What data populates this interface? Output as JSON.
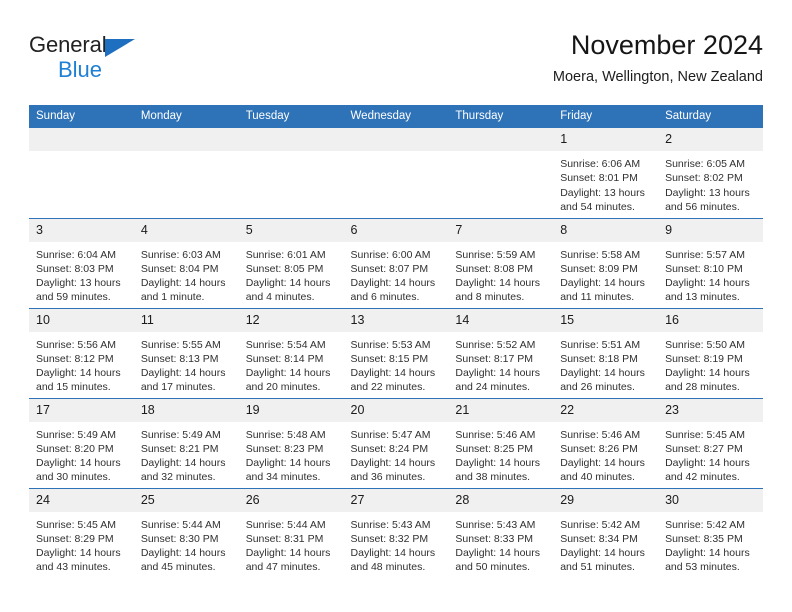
{
  "brand": {
    "word1": "General",
    "word2": "Blue",
    "triangle_color": "#1f6fc0",
    "word2_color": "#1f7fd4"
  },
  "header": {
    "title": "November 2024",
    "subtitle": "Moera, Wellington, New Zealand",
    "header_bg": "#2e72b8",
    "header_text": "#ffffff",
    "daynum_bg": "#f0f0f0"
  },
  "weekdays": [
    "Sunday",
    "Monday",
    "Tuesday",
    "Wednesday",
    "Thursday",
    "Friday",
    "Saturday"
  ],
  "weeks": [
    [
      {
        "day": "",
        "lines": []
      },
      {
        "day": "",
        "lines": []
      },
      {
        "day": "",
        "lines": []
      },
      {
        "day": "",
        "lines": []
      },
      {
        "day": "",
        "lines": []
      },
      {
        "day": "1",
        "lines": [
          "Sunrise: 6:06 AM",
          "Sunset: 8:01 PM",
          "Daylight: 13 hours",
          "and 54 minutes."
        ]
      },
      {
        "day": "2",
        "lines": [
          "Sunrise: 6:05 AM",
          "Sunset: 8:02 PM",
          "Daylight: 13 hours",
          "and 56 minutes."
        ]
      }
    ],
    [
      {
        "day": "3",
        "lines": [
          "Sunrise: 6:04 AM",
          "Sunset: 8:03 PM",
          "Daylight: 13 hours",
          "and 59 minutes."
        ]
      },
      {
        "day": "4",
        "lines": [
          "Sunrise: 6:03 AM",
          "Sunset: 8:04 PM",
          "Daylight: 14 hours",
          "and 1 minute."
        ]
      },
      {
        "day": "5",
        "lines": [
          "Sunrise: 6:01 AM",
          "Sunset: 8:05 PM",
          "Daylight: 14 hours",
          "and 4 minutes."
        ]
      },
      {
        "day": "6",
        "lines": [
          "Sunrise: 6:00 AM",
          "Sunset: 8:07 PM",
          "Daylight: 14 hours",
          "and 6 minutes."
        ]
      },
      {
        "day": "7",
        "lines": [
          "Sunrise: 5:59 AM",
          "Sunset: 8:08 PM",
          "Daylight: 14 hours",
          "and 8 minutes."
        ]
      },
      {
        "day": "8",
        "lines": [
          "Sunrise: 5:58 AM",
          "Sunset: 8:09 PM",
          "Daylight: 14 hours",
          "and 11 minutes."
        ]
      },
      {
        "day": "9",
        "lines": [
          "Sunrise: 5:57 AM",
          "Sunset: 8:10 PM",
          "Daylight: 14 hours",
          "and 13 minutes."
        ]
      }
    ],
    [
      {
        "day": "10",
        "lines": [
          "Sunrise: 5:56 AM",
          "Sunset: 8:12 PM",
          "Daylight: 14 hours",
          "and 15 minutes."
        ]
      },
      {
        "day": "11",
        "lines": [
          "Sunrise: 5:55 AM",
          "Sunset: 8:13 PM",
          "Daylight: 14 hours",
          "and 17 minutes."
        ]
      },
      {
        "day": "12",
        "lines": [
          "Sunrise: 5:54 AM",
          "Sunset: 8:14 PM",
          "Daylight: 14 hours",
          "and 20 minutes."
        ]
      },
      {
        "day": "13",
        "lines": [
          "Sunrise: 5:53 AM",
          "Sunset: 8:15 PM",
          "Daylight: 14 hours",
          "and 22 minutes."
        ]
      },
      {
        "day": "14",
        "lines": [
          "Sunrise: 5:52 AM",
          "Sunset: 8:17 PM",
          "Daylight: 14 hours",
          "and 24 minutes."
        ]
      },
      {
        "day": "15",
        "lines": [
          "Sunrise: 5:51 AM",
          "Sunset: 8:18 PM",
          "Daylight: 14 hours",
          "and 26 minutes."
        ]
      },
      {
        "day": "16",
        "lines": [
          "Sunrise: 5:50 AM",
          "Sunset: 8:19 PM",
          "Daylight: 14 hours",
          "and 28 minutes."
        ]
      }
    ],
    [
      {
        "day": "17",
        "lines": [
          "Sunrise: 5:49 AM",
          "Sunset: 8:20 PM",
          "Daylight: 14 hours",
          "and 30 minutes."
        ]
      },
      {
        "day": "18",
        "lines": [
          "Sunrise: 5:49 AM",
          "Sunset: 8:21 PM",
          "Daylight: 14 hours",
          "and 32 minutes."
        ]
      },
      {
        "day": "19",
        "lines": [
          "Sunrise: 5:48 AM",
          "Sunset: 8:23 PM",
          "Daylight: 14 hours",
          "and 34 minutes."
        ]
      },
      {
        "day": "20",
        "lines": [
          "Sunrise: 5:47 AM",
          "Sunset: 8:24 PM",
          "Daylight: 14 hours",
          "and 36 minutes."
        ]
      },
      {
        "day": "21",
        "lines": [
          "Sunrise: 5:46 AM",
          "Sunset: 8:25 PM",
          "Daylight: 14 hours",
          "and 38 minutes."
        ]
      },
      {
        "day": "22",
        "lines": [
          "Sunrise: 5:46 AM",
          "Sunset: 8:26 PM",
          "Daylight: 14 hours",
          "and 40 minutes."
        ]
      },
      {
        "day": "23",
        "lines": [
          "Sunrise: 5:45 AM",
          "Sunset: 8:27 PM",
          "Daylight: 14 hours",
          "and 42 minutes."
        ]
      }
    ],
    [
      {
        "day": "24",
        "lines": [
          "Sunrise: 5:45 AM",
          "Sunset: 8:29 PM",
          "Daylight: 14 hours",
          "and 43 minutes."
        ]
      },
      {
        "day": "25",
        "lines": [
          "Sunrise: 5:44 AM",
          "Sunset: 8:30 PM",
          "Daylight: 14 hours",
          "and 45 minutes."
        ]
      },
      {
        "day": "26",
        "lines": [
          "Sunrise: 5:44 AM",
          "Sunset: 8:31 PM",
          "Daylight: 14 hours",
          "and 47 minutes."
        ]
      },
      {
        "day": "27",
        "lines": [
          "Sunrise: 5:43 AM",
          "Sunset: 8:32 PM",
          "Daylight: 14 hours",
          "and 48 minutes."
        ]
      },
      {
        "day": "28",
        "lines": [
          "Sunrise: 5:43 AM",
          "Sunset: 8:33 PM",
          "Daylight: 14 hours",
          "and 50 minutes."
        ]
      },
      {
        "day": "29",
        "lines": [
          "Sunrise: 5:42 AM",
          "Sunset: 8:34 PM",
          "Daylight: 14 hours",
          "and 51 minutes."
        ]
      },
      {
        "day": "30",
        "lines": [
          "Sunrise: 5:42 AM",
          "Sunset: 8:35 PM",
          "Daylight: 14 hours",
          "and 53 minutes."
        ]
      }
    ]
  ]
}
